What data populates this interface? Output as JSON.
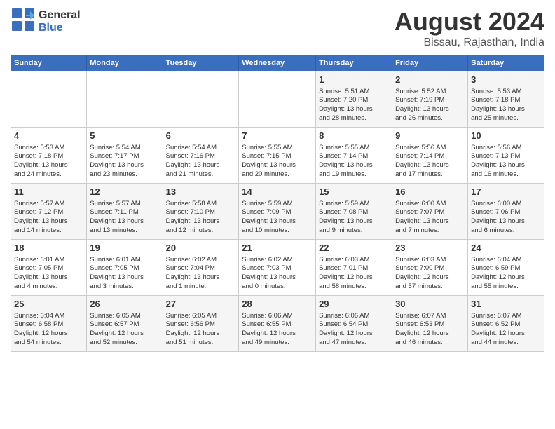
{
  "logo": {
    "line1": "General",
    "line2": "Blue"
  },
  "title": "August 2024",
  "location": "Bissau, Rajasthan, India",
  "days_of_week": [
    "Sunday",
    "Monday",
    "Tuesday",
    "Wednesday",
    "Thursday",
    "Friday",
    "Saturday"
  ],
  "weeks": [
    [
      {
        "day": "",
        "content": ""
      },
      {
        "day": "",
        "content": ""
      },
      {
        "day": "",
        "content": ""
      },
      {
        "day": "",
        "content": ""
      },
      {
        "day": "1",
        "content": "Sunrise: 5:51 AM\nSunset: 7:20 PM\nDaylight: 13 hours\nand 28 minutes."
      },
      {
        "day": "2",
        "content": "Sunrise: 5:52 AM\nSunset: 7:19 PM\nDaylight: 13 hours\nand 26 minutes."
      },
      {
        "day": "3",
        "content": "Sunrise: 5:53 AM\nSunset: 7:18 PM\nDaylight: 13 hours\nand 25 minutes."
      }
    ],
    [
      {
        "day": "4",
        "content": "Sunrise: 5:53 AM\nSunset: 7:18 PM\nDaylight: 13 hours\nand 24 minutes."
      },
      {
        "day": "5",
        "content": "Sunrise: 5:54 AM\nSunset: 7:17 PM\nDaylight: 13 hours\nand 23 minutes."
      },
      {
        "day": "6",
        "content": "Sunrise: 5:54 AM\nSunset: 7:16 PM\nDaylight: 13 hours\nand 21 minutes."
      },
      {
        "day": "7",
        "content": "Sunrise: 5:55 AM\nSunset: 7:15 PM\nDaylight: 13 hours\nand 20 minutes."
      },
      {
        "day": "8",
        "content": "Sunrise: 5:55 AM\nSunset: 7:14 PM\nDaylight: 13 hours\nand 19 minutes."
      },
      {
        "day": "9",
        "content": "Sunrise: 5:56 AM\nSunset: 7:14 PM\nDaylight: 13 hours\nand 17 minutes."
      },
      {
        "day": "10",
        "content": "Sunrise: 5:56 AM\nSunset: 7:13 PM\nDaylight: 13 hours\nand 16 minutes."
      }
    ],
    [
      {
        "day": "11",
        "content": "Sunrise: 5:57 AM\nSunset: 7:12 PM\nDaylight: 13 hours\nand 14 minutes."
      },
      {
        "day": "12",
        "content": "Sunrise: 5:57 AM\nSunset: 7:11 PM\nDaylight: 13 hours\nand 13 minutes."
      },
      {
        "day": "13",
        "content": "Sunrise: 5:58 AM\nSunset: 7:10 PM\nDaylight: 13 hours\nand 12 minutes."
      },
      {
        "day": "14",
        "content": "Sunrise: 5:59 AM\nSunset: 7:09 PM\nDaylight: 13 hours\nand 10 minutes."
      },
      {
        "day": "15",
        "content": "Sunrise: 5:59 AM\nSunset: 7:08 PM\nDaylight: 13 hours\nand 9 minutes."
      },
      {
        "day": "16",
        "content": "Sunrise: 6:00 AM\nSunset: 7:07 PM\nDaylight: 13 hours\nand 7 minutes."
      },
      {
        "day": "17",
        "content": "Sunrise: 6:00 AM\nSunset: 7:06 PM\nDaylight: 13 hours\nand 6 minutes."
      }
    ],
    [
      {
        "day": "18",
        "content": "Sunrise: 6:01 AM\nSunset: 7:05 PM\nDaylight: 13 hours\nand 4 minutes."
      },
      {
        "day": "19",
        "content": "Sunrise: 6:01 AM\nSunset: 7:05 PM\nDaylight: 13 hours\nand 3 minutes."
      },
      {
        "day": "20",
        "content": "Sunrise: 6:02 AM\nSunset: 7:04 PM\nDaylight: 13 hours\nand 1 minute."
      },
      {
        "day": "21",
        "content": "Sunrise: 6:02 AM\nSunset: 7:03 PM\nDaylight: 13 hours\nand 0 minutes."
      },
      {
        "day": "22",
        "content": "Sunrise: 6:03 AM\nSunset: 7:01 PM\nDaylight: 12 hours\nand 58 minutes."
      },
      {
        "day": "23",
        "content": "Sunrise: 6:03 AM\nSunset: 7:00 PM\nDaylight: 12 hours\nand 57 minutes."
      },
      {
        "day": "24",
        "content": "Sunrise: 6:04 AM\nSunset: 6:59 PM\nDaylight: 12 hours\nand 55 minutes."
      }
    ],
    [
      {
        "day": "25",
        "content": "Sunrise: 6:04 AM\nSunset: 6:58 PM\nDaylight: 12 hours\nand 54 minutes."
      },
      {
        "day": "26",
        "content": "Sunrise: 6:05 AM\nSunset: 6:57 PM\nDaylight: 12 hours\nand 52 minutes."
      },
      {
        "day": "27",
        "content": "Sunrise: 6:05 AM\nSunset: 6:56 PM\nDaylight: 12 hours\nand 51 minutes."
      },
      {
        "day": "28",
        "content": "Sunrise: 6:06 AM\nSunset: 6:55 PM\nDaylight: 12 hours\nand 49 minutes."
      },
      {
        "day": "29",
        "content": "Sunrise: 6:06 AM\nSunset: 6:54 PM\nDaylight: 12 hours\nand 47 minutes."
      },
      {
        "day": "30",
        "content": "Sunrise: 6:07 AM\nSunset: 6:53 PM\nDaylight: 12 hours\nand 46 minutes."
      },
      {
        "day": "31",
        "content": "Sunrise: 6:07 AM\nSunset: 6:52 PM\nDaylight: 12 hours\nand 44 minutes."
      }
    ]
  ]
}
